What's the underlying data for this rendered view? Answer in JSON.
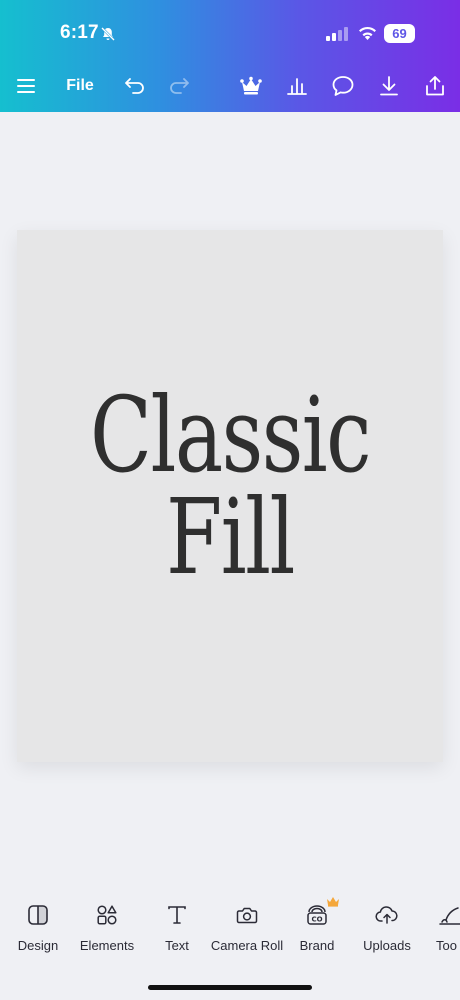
{
  "status_bar": {
    "time": "6:17",
    "battery": "69",
    "icons": [
      "bell-off-icon",
      "signal-icon",
      "wifi-icon",
      "battery-icon"
    ]
  },
  "toolbar": {
    "menu_icon": "hamburger-icon",
    "file_label": "File",
    "undo_icon": "undo-icon",
    "redo_icon": "redo-icon",
    "premium_icon": "crown-icon",
    "insights_icon": "bar-chart-icon",
    "comment_icon": "comment-icon",
    "download_icon": "download-icon",
    "share_icon": "share-icon",
    "gradient": [
      "#15bfcf",
      "#7a2ee6"
    ]
  },
  "design": {
    "line1": "Classic",
    "line2": "Fill",
    "background": "#e6e6e7",
    "text_color": "#2f2f2f"
  },
  "bottom_tabs": [
    {
      "label": "Design",
      "icon": "design-icon"
    },
    {
      "label": "Elements",
      "icon": "elements-icon"
    },
    {
      "label": "Text",
      "icon": "text-icon"
    },
    {
      "label": "Camera Roll",
      "icon": "camera-icon"
    },
    {
      "label": "Brand",
      "icon": "brand-icon",
      "badge": "crown-icon"
    },
    {
      "label": "Uploads",
      "icon": "cloud-upload-icon"
    },
    {
      "label": "Too",
      "icon": "tools-icon"
    }
  ],
  "accent_crown_color": "#f4a73b"
}
